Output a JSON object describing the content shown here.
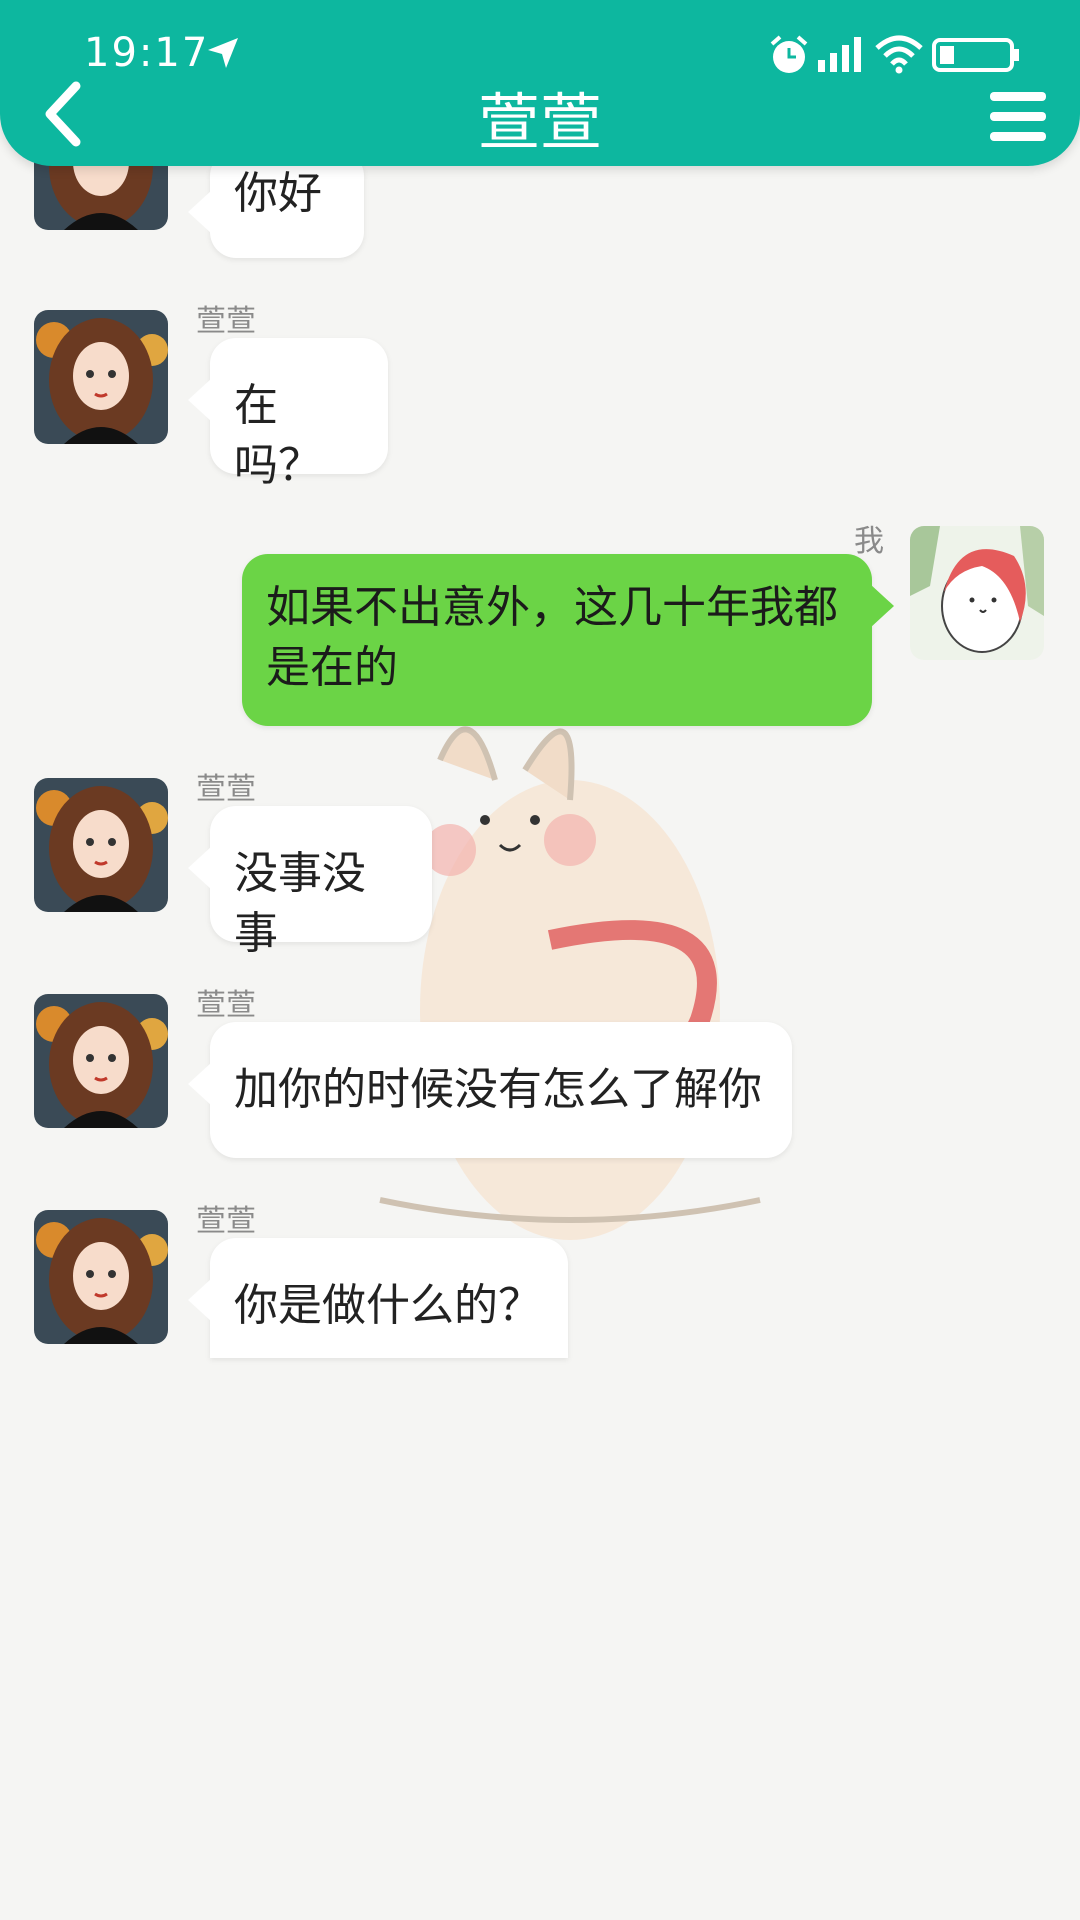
{
  "status_bar": {
    "time": "19:17"
  },
  "header": {
    "title": "萱萱"
  },
  "messages": [
    {
      "sender": "",
      "text": "你好"
    },
    {
      "sender": "萱萱",
      "text": "在吗？"
    },
    {
      "sender": "我",
      "text": "如果不出意外，这几十年我都是在的"
    },
    {
      "sender": "萱萱",
      "text": "没事没事"
    },
    {
      "sender": "萱萱",
      "text": "加你的时候没有怎么了解你"
    },
    {
      "sender": "萱萱",
      "text": "你是做什么的？"
    }
  ],
  "colors": {
    "header": "#0db79f",
    "outgoing_bubble": "#6bd446",
    "incoming_bubble": "#ffffff",
    "background": "#f5f5f3"
  }
}
